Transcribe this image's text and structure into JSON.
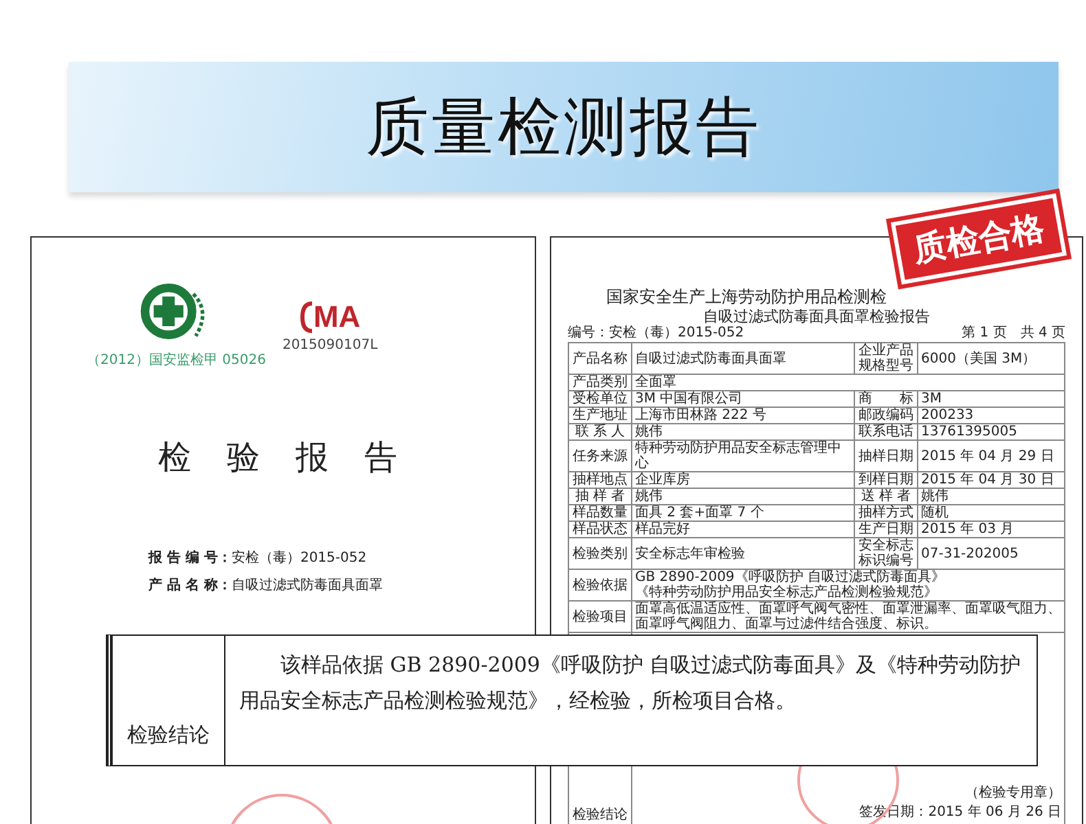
{
  "banner": {
    "title": "质量检测报告"
  },
  "cover_document": {
    "logos": [
      {
        "kind": "safety",
        "caption": "（2012）国安监检甲 05026"
      },
      {
        "kind": "cma",
        "mark": "MA",
        "caption": "2015090107L"
      }
    ],
    "title": "检验报告",
    "fields": [
      {
        "label": "报 告 编 号：",
        "value": "安检（毒）2015-052"
      },
      {
        "label": "产 品 名 称：",
        "value": "自吸过滤式防毒面具面罩"
      }
    ]
  },
  "report_document": {
    "title": "国家安全生产上海劳动防护用品检测检",
    "subtitle": "自吸过滤式防毒面具面罩检验报告",
    "number": "编号：安检（毒）2015-052",
    "page": "第 1 页　共 4 页",
    "rows": [
      {
        "label": "产品名称",
        "value": [
          "自吸过滤式防毒面具面罩"
        ],
        "label_2": "企业产品规格型号",
        "value_2": "6000（美国 3M）"
      },
      {
        "label": "产品类别",
        "value": [
          "全面罩"
        ]
      },
      {
        "label": "受检单位",
        "value": [
          "3M 中国有限公司"
        ],
        "label_2": "商　　标",
        "value_2": "3M"
      },
      {
        "label": "生产地址",
        "value": [
          "上海市田林路 222 号"
        ],
        "label_2": "邮政编码",
        "value_2": "200233"
      },
      {
        "label": "联 系 人",
        "value": [
          "姚伟"
        ],
        "label_2": "联系电话",
        "value_2": "13761395005"
      },
      {
        "label": "任务来源",
        "value": [
          "特种劳动防护用品安全标志管理中心"
        ],
        "label_2": "抽样日期",
        "value_2": "2015 年 04 月 29 日"
      },
      {
        "label": "抽样地点",
        "value": [
          "企业库房"
        ],
        "label_2": "到样日期",
        "value_2": "2015 年 04 月 30 日"
      },
      {
        "label": "抽 样 者",
        "value": [
          "姚伟"
        ],
        "label_2": "送 样 者",
        "value_2": "姚伟"
      },
      {
        "label": "样品数量",
        "value": [
          "面具 2 套+面罩 7 个"
        ],
        "label_2": "抽样方式",
        "value_2": "随机"
      },
      {
        "label": "样品状态",
        "value": [
          "样品完好"
        ],
        "label_2": "生产日期",
        "value_2": "2015 年 03 月"
      },
      {
        "label": "检验类别",
        "value": [
          "安全标志年审检验"
        ],
        "label_2": "安全标志标识编号",
        "value_2": "07-31-202005"
      },
      {
        "label": "检验依据",
        "value": [
          "GB 2890-2009《呼吸防护 自吸过滤式防毒面具》",
          "《特种劳动防护用品安全标志产品检测检验规范》"
        ]
      },
      {
        "label": "检验项目",
        "value": [
          "面罩高低温适应性、面罩呼气阀气密性、面罩泄漏率、面罩吸气阻力、面罩呼气阀阻力、面罩与过滤件结合强度、标识。"
        ]
      }
    ],
    "conclusion": {
      "label": "检验结论",
      "seal_caption": "（检验专用章）",
      "date": "签发日期：2015 年 06 月 26 日"
    },
    "stamp": "质检合格"
  },
  "conclusion_callout": {
    "label": "检验结论",
    "text": "该样品依据 GB 2890-2009《呼吸防护  自吸过滤式防毒面具》及《特种劳动防护用品安全标志产品检测检验规范》，经检验，所检项目合格。"
  }
}
